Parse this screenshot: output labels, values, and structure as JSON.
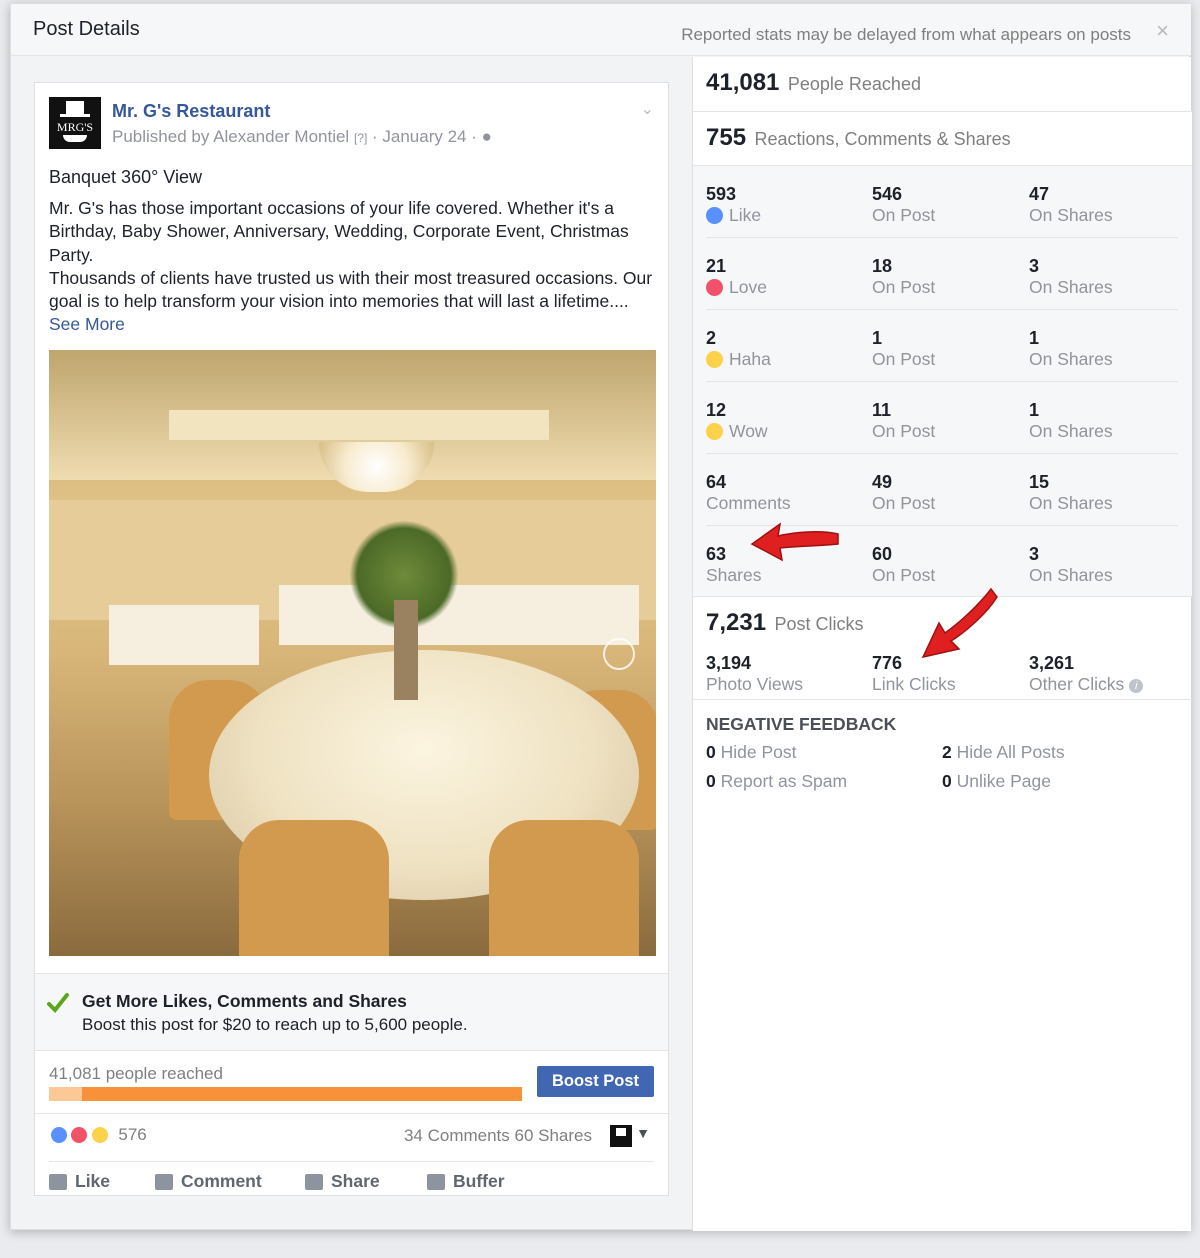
{
  "header": {
    "title": "Post Details",
    "note": "Reported stats may be delayed from what appears on posts",
    "close": "×"
  },
  "post": {
    "page_name": "Mr. G's Restaurant",
    "avatar_text": "MRG'S",
    "byline_prefix": "Published by Alexander Montiel",
    "byline_q": "[?]",
    "byline_date": "· January 24 ·",
    "title": "Banquet 360° View",
    "body": "Mr. G's has those important occasions of your life covered. Whether it's a Birthday, Baby Shower, Anniversary, Wedding, Corporate Event, Christmas Party.\nThousands of clients have trusted us with their most treasured occasions. Our goal is to help transform your vision into memories that will last a lifetime....",
    "see_more": "See More"
  },
  "boost": {
    "heading": "Get More Likes, Comments and Shares",
    "sub": "Boost this post for $20 to reach up to 5,600 people.",
    "reach_text": "41,081 people reached",
    "button": "Boost Post",
    "reach_fraction_light": 0.07
  },
  "footer": {
    "reaction_count": "576",
    "comments_shares": "34 Comments  60 Shares",
    "actions": [
      "Like",
      "Comment",
      "Share",
      "Buffer"
    ]
  },
  "stats": {
    "reached_num": "41,081",
    "reached_label": "People Reached",
    "rcs_num": "755",
    "rcs_label": "Reactions, Comments & Shares",
    "rows": [
      {
        "n1": "593",
        "l1": "Like",
        "n2": "546",
        "l2": "On Post",
        "n3": "47",
        "l3": "On Shares"
      },
      {
        "n1": "21",
        "l1": "Love",
        "n2": "18",
        "l2": "On Post",
        "n3": "3",
        "l3": "On Shares"
      },
      {
        "n1": "2",
        "l1": "Haha",
        "n2": "1",
        "l2": "On Post",
        "n3": "1",
        "l3": "On Shares"
      },
      {
        "n1": "12",
        "l1": "Wow",
        "n2": "11",
        "l2": "On Post",
        "n3": "1",
        "l3": "On Shares"
      },
      {
        "n1": "64",
        "l1": "Comments",
        "n2": "49",
        "l2": "On Post",
        "n3": "15",
        "l3": "On Shares"
      },
      {
        "n1": "63",
        "l1": "Shares",
        "n2": "60",
        "l2": "On Post",
        "n3": "3",
        "l3": "On Shares"
      }
    ],
    "clicks_num": "7,231",
    "clicks_label": "Post Clicks",
    "photo_views_num": "3,194",
    "photo_views_label": "Photo Views",
    "link_clicks_num": "776",
    "link_clicks_label": "Link Clicks",
    "other_clicks_num": "3,261",
    "other_clicks_label": "Other Clicks",
    "negative": {
      "title": "NEGATIVE FEEDBACK",
      "hide_post_num": "0",
      "hide_post": "Hide Post",
      "hide_all_num": "2",
      "hide_all": "Hide All Posts",
      "spam_num": "0",
      "spam": "Report as Spam",
      "unlike_num": "0",
      "unlike": "Unlike Page"
    }
  },
  "colors": {
    "link_blue": "#365899",
    "button_blue": "#4267b2",
    "reach_orange": "#f7923a",
    "arrow_red": "#e02020"
  }
}
